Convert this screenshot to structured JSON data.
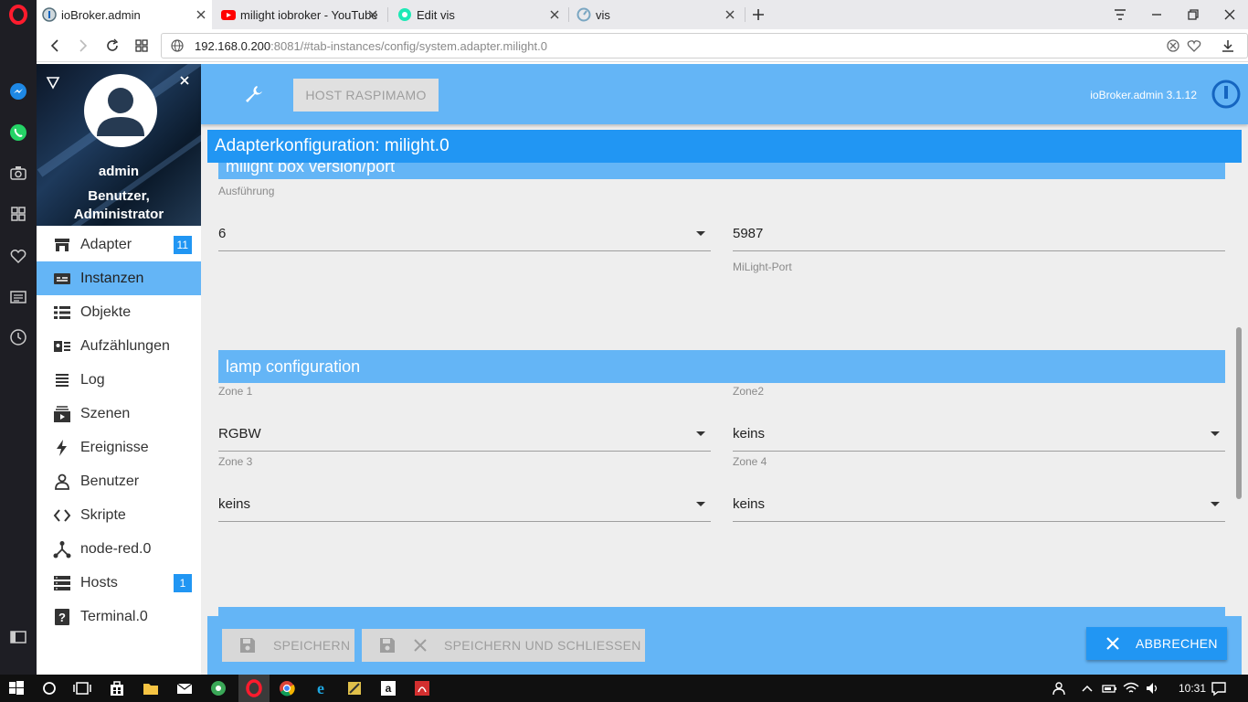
{
  "browser": {
    "tabs": [
      {
        "title": "ioBroker.admin",
        "active": true
      },
      {
        "title": "milight iobroker - YouTube",
        "active": false
      },
      {
        "title": "Edit vis",
        "active": false
      },
      {
        "title": "vis",
        "active": false
      }
    ],
    "url_host": "192.168.0.200",
    "url_rest": ":8081/#tab-instances/config/system.adapter.milight.0"
  },
  "sidebar": {
    "profile": {
      "name": "admin",
      "roles_line1": "Benutzer,",
      "roles_line2": "Administrator"
    },
    "items": [
      {
        "label": "Adapter",
        "badge": "11",
        "icon": "adapter-icon"
      },
      {
        "label": "Instanzen",
        "badge": "",
        "icon": "instances-icon",
        "active": true
      },
      {
        "label": "Objekte",
        "badge": "",
        "icon": "objects-icon"
      },
      {
        "label": "Aufzählungen",
        "badge": "",
        "icon": "enums-icon"
      },
      {
        "label": "Log",
        "badge": "",
        "icon": "log-icon"
      },
      {
        "label": "Szenen",
        "badge": "",
        "icon": "scenes-icon"
      },
      {
        "label": "Ereignisse",
        "badge": "",
        "icon": "events-icon"
      },
      {
        "label": "Benutzer",
        "badge": "",
        "icon": "user-icon"
      },
      {
        "label": "Skripte",
        "badge": "",
        "icon": "scripts-icon"
      },
      {
        "label": "node-red.0",
        "badge": "",
        "icon": "node-red-icon"
      },
      {
        "label": "Hosts",
        "badge": "1",
        "icon": "hosts-icon"
      },
      {
        "label": "Terminal.0",
        "badge": "",
        "icon": "terminal-icon"
      }
    ]
  },
  "header": {
    "host_button": "HOST RASPIMAMO",
    "version": "ioBroker.admin 3.1.12"
  },
  "dialog": {
    "title": "Adapterkonfiguration: milight.0",
    "section1": {
      "title": "milight box version/port",
      "version_label": "Ausführung",
      "version_value": "6",
      "port_value": "5987",
      "port_label": "MiLight-Port"
    },
    "section2": {
      "title": "lamp configuration",
      "zone1_label": "Zone 1",
      "zone1_value": "RGBW",
      "zone2_label": "Zone2",
      "zone2_value": "keins",
      "zone3_label": "Zone 3",
      "zone3_value": "keins",
      "zone4_label": "Zone 4",
      "zone4_value": "keins"
    },
    "footer": {
      "save": "SPEICHERN",
      "save_close": "SPEICHERN UND SCHLIESSEN",
      "cancel": "ABBRECHEN"
    }
  },
  "taskbar": {
    "time": "10:31"
  },
  "colors": {
    "primary": "#2196f3",
    "light_primary": "#64b5f6",
    "background": "#eeeeee"
  }
}
